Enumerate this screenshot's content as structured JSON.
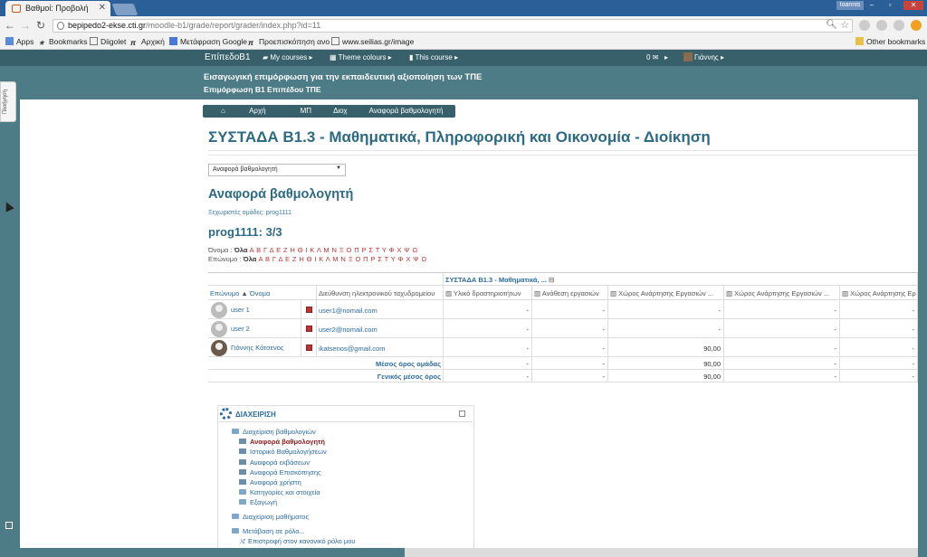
{
  "browser": {
    "tab_title": "Βαθμοί: Προβολή",
    "user_chip": "Ioannis",
    "url_host": "bepipedo2-ekse.cti.gr",
    "url_path": "/moodle-b1/grade/report/grader/index.php?id=11",
    "bookmarks": [
      "Apps",
      "Bookmarks",
      "Diigolet",
      "Αρχική",
      "Μετάφραση Google",
      "Προεπισκόπηση ανο",
      "www.seilias.gr/image",
      "Other bookmarks"
    ]
  },
  "navbar": {
    "brand": "ΕπίπεδοΒ1",
    "my_courses": "My courses",
    "theme_colours": "Theme colours",
    "this_course": "This course",
    "messages": "0",
    "user": "Γιάννης"
  },
  "header": {
    "line1": "Εισαγωγική επιμόρφωση για την εκπαιδευτική αξιοποίηση των ΤΠΕ",
    "line2": "Επιμόρφωση Β1 Επιπέδου ΤΠΕ"
  },
  "side_tab": "Πλοήγηση",
  "breadcrumb": [
    "Αρχή",
    "ΜΠ",
    "Διοχ",
    "Αναφορά βαθμολογητή"
  ],
  "course_title": "ΣΥΣΤΑΔΑ Β1.3 - Μαθηματικά, Πληροφορική και Οικονομία - Διοίκηση",
  "report_select": "Αναφορά βαθμολογητή",
  "report_title": "Αναφορά βαθμολογητή",
  "groups_line": "Ξεχωριστές ομάδες: prog1111",
  "group_heading": "prog1111: 3/3",
  "initials": {
    "firstname_label": "Όνομα :",
    "lastname_label": "Επώνυμο :",
    "all": "Όλα",
    "letters": "Α Β Γ Δ Ε Ζ Η Θ Ι Κ Λ Μ Ν Ξ Ο Π Ρ Σ Τ Υ Φ Χ Ψ Ω"
  },
  "grader": {
    "category_header": "ΣΥΣΤΑΔΑ Β1.3 - Μαθηματικά, ...",
    "col_lastname": "Επώνυμο",
    "col_firstname": "Όνομα",
    "col_email": "Διεύθυνση ηλεκτρονικού ταχυδρομείου",
    "item_headers": [
      "Υλικό δραστηριοτήτων",
      "Ανάθεση εργασιών",
      "Χώρος Ανάρτησης Εργασιών ...",
      "Χώρος Ανάρτησης Εργασιών ...",
      "Χώρος Ανάρτησης Ερ"
    ],
    "rows": [
      {
        "name": "user 1",
        "email": "user1@nomail.com",
        "grades": [
          "-",
          "-",
          "-",
          "-",
          "-"
        ]
      },
      {
        "name": "user 2",
        "email": "user2@nomail.com",
        "grades": [
          "-",
          "-",
          "-",
          "-",
          "-"
        ]
      },
      {
        "name": "Γιάννης Κότσενος",
        "email": "ikatsenos@gmail.com",
        "grades": [
          "-",
          "-",
          "90,00",
          "-",
          "-"
        ]
      }
    ],
    "group_avg_label": "Μέσος όρος ομάδας",
    "group_avg": [
      "-",
      "-",
      "90,00",
      "-",
      "-"
    ],
    "overall_avg_label": "Γενικός μέσος όρος",
    "overall_avg": [
      "-",
      "-",
      "90,00",
      "-",
      "-"
    ]
  },
  "admin": {
    "title": "ΔΙΑΧΕΙΡΙΣΗ",
    "grades_admin": "Διαχείριση βαθμολογιών",
    "items": [
      "Αναφορά βαθμολογητή",
      "Ιστορικό Βαθμολογήσεων",
      "Αναφορά εκβάσεων",
      "Αναφορά Επισκόπησης",
      "Αναφορά χρήστη",
      "Κατηγορίες και στοιχεία",
      "Εξαγωγή"
    ],
    "course_admin": "Διαχείριση μαθήματος",
    "switch_role": "Μετάβαση σε ρόλο...",
    "return_role": "Επιστροφή στον κανονικό ρόλο μου"
  }
}
